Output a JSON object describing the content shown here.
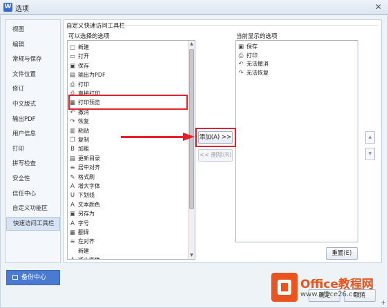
{
  "window": {
    "title": "选项",
    "app_icon": "W",
    "close_glyph": "✕"
  },
  "sidebar": {
    "items": [
      {
        "label": "视图"
      },
      {
        "label": "编辑"
      },
      {
        "label": "常规与保存"
      },
      {
        "label": "文件位置"
      },
      {
        "label": "修订"
      },
      {
        "label": "中文版式"
      },
      {
        "label": "输出PDF"
      },
      {
        "label": "用户信息"
      },
      {
        "label": "打印"
      },
      {
        "label": "拼写检查"
      },
      {
        "label": "安全性"
      },
      {
        "label": "信任中心"
      },
      {
        "label": "自定义功能区"
      },
      {
        "label": "快速访问工具栏"
      }
    ],
    "active_index": 13,
    "backup_label": "备份中心"
  },
  "main": {
    "section_title": "自定义快速访问工具栏",
    "available_label": "可以选择的选项",
    "current_label": "当前显示的选项",
    "available_items": [
      {
        "label": "新建",
        "icon": "new-doc-icon",
        "glyph": "▢"
      },
      {
        "label": "打开",
        "icon": "open-folder-icon",
        "glyph": "▭"
      },
      {
        "label": "保存",
        "icon": "save-icon",
        "glyph": "▣"
      },
      {
        "label": "输出为PDF",
        "icon": "pdf-icon",
        "glyph": "▤"
      },
      {
        "label": "打印",
        "icon": "printer-icon",
        "glyph": "⎙"
      },
      {
        "label": "直接打印",
        "icon": "direct-print-icon",
        "glyph": "⎙"
      },
      {
        "label": "打印预览",
        "icon": "print-preview-icon",
        "glyph": "▦"
      },
      {
        "label": "撤消",
        "icon": "undo-icon",
        "glyph": "↶"
      },
      {
        "label": "恢复",
        "icon": "redo-icon",
        "glyph": "↷"
      },
      {
        "label": "粘贴",
        "icon": "paste-icon",
        "glyph": "▥"
      },
      {
        "label": "复制",
        "icon": "copy-icon",
        "glyph": "❐"
      },
      {
        "label": "加粗",
        "icon": "bold-icon",
        "glyph": "B"
      },
      {
        "label": "更新目录",
        "icon": "update-toc-icon",
        "glyph": "▤"
      },
      {
        "label": "居中对齐",
        "icon": "align-center-icon",
        "glyph": "≡"
      },
      {
        "label": "格式刷",
        "icon": "format-painter-icon",
        "glyph": "✎"
      },
      {
        "label": "增大字体",
        "icon": "grow-font-icon",
        "glyph": "A"
      },
      {
        "label": "下划线",
        "icon": "underline-icon",
        "glyph": "U"
      },
      {
        "label": "文本颜色",
        "icon": "font-color-icon",
        "glyph": "A"
      },
      {
        "label": "另存为",
        "icon": "save-as-icon",
        "glyph": "▣"
      },
      {
        "label": "字号",
        "icon": "font-size-icon",
        "glyph": "A"
      },
      {
        "label": "翻译",
        "icon": "translate-icon",
        "glyph": "▦"
      },
      {
        "label": "左对齐",
        "icon": "align-left-icon",
        "glyph": "≡"
      },
      {
        "label": "新建",
        "icon": "none",
        "glyph": ""
      },
      {
        "label": "减小字体",
        "icon": "shrink-font-icon",
        "glyph": "A"
      }
    ],
    "selected_available_index": 6,
    "current_items": [
      {
        "label": "保存",
        "icon": "save-icon",
        "glyph": "▣"
      },
      {
        "label": "打印",
        "icon": "printer-icon",
        "glyph": "⎙"
      },
      {
        "label": "无法撤消",
        "icon": "undo-icon",
        "glyph": "↶"
      },
      {
        "label": "无法恢复",
        "icon": "redo-icon",
        "glyph": "↷"
      }
    ],
    "add_button": "添加(A) >>",
    "remove_button": "<< 删除(R)",
    "reset_button": "重置(E)",
    "move_up_glyph": "▲",
    "move_down_glyph": "▼"
  },
  "footer": {
    "ok_button": "确定",
    "cancel_button": "取消"
  },
  "watermark": {
    "title": "Office教程网",
    "url": "www.office26.com",
    "corner": "+"
  },
  "colors": {
    "accent_red": "#e8202a",
    "backup_blue": "#4a7bd0",
    "brand_orange": "#e8551e"
  }
}
